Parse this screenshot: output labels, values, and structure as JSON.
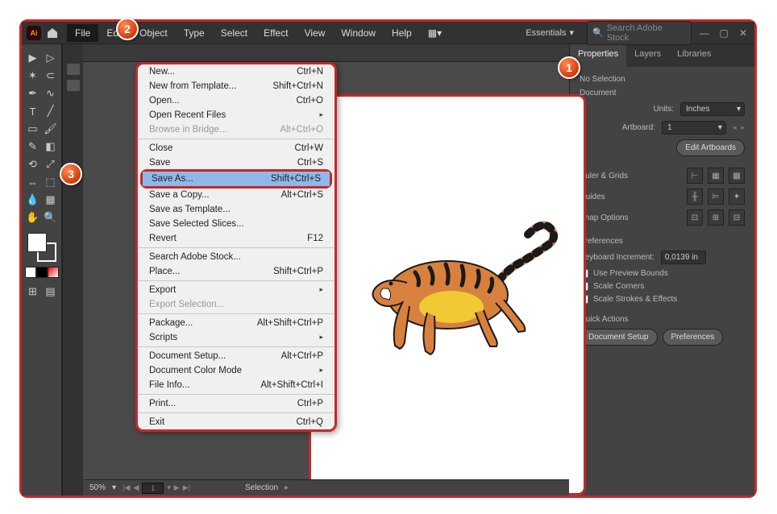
{
  "menubar": {
    "items": [
      "File",
      "Edit",
      "Object",
      "Type",
      "Select",
      "Effect",
      "View",
      "Window",
      "Help"
    ],
    "essentials": "Essentials",
    "search_placeholder": "Search Adobe Stock"
  },
  "dropdown": {
    "items": [
      {
        "label": "New...",
        "shortcut": "Ctrl+N"
      },
      {
        "label": "New from Template...",
        "shortcut": "Shift+Ctrl+N"
      },
      {
        "label": "Open...",
        "shortcut": "Ctrl+O"
      },
      {
        "label": "Open Recent Files",
        "sub": true
      },
      {
        "label": "Browse in Bridge...",
        "shortcut": "Alt+Ctrl+O",
        "disabled": true
      },
      {
        "sep": true
      },
      {
        "label": "Close",
        "shortcut": "Ctrl+W"
      },
      {
        "label": "Save",
        "shortcut": "Ctrl+S"
      },
      {
        "label": "Save As...",
        "shortcut": "Shift+Ctrl+S",
        "highlight": true
      },
      {
        "label": "Save a Copy...",
        "shortcut": "Alt+Ctrl+S"
      },
      {
        "label": "Save as Template..."
      },
      {
        "label": "Save Selected Slices..."
      },
      {
        "label": "Revert",
        "shortcut": "F12"
      },
      {
        "sep": true
      },
      {
        "label": "Search Adobe Stock..."
      },
      {
        "label": "Place...",
        "shortcut": "Shift+Ctrl+P"
      },
      {
        "sep": true
      },
      {
        "label": "Export",
        "sub": true
      },
      {
        "label": "Export Selection...",
        "disabled": true
      },
      {
        "sep": true
      },
      {
        "label": "Package...",
        "shortcut": "Alt+Shift+Ctrl+P"
      },
      {
        "label": "Scripts",
        "sub": true
      },
      {
        "sep": true
      },
      {
        "label": "Document Setup...",
        "shortcut": "Alt+Ctrl+P"
      },
      {
        "label": "Document Color Mode",
        "sub": true
      },
      {
        "label": "File Info...",
        "shortcut": "Alt+Shift+Ctrl+I"
      },
      {
        "sep": true
      },
      {
        "label": "Print...",
        "shortcut": "Ctrl+P"
      },
      {
        "sep": true
      },
      {
        "label": "Exit",
        "shortcut": "Ctrl+Q"
      }
    ]
  },
  "status": {
    "zoom": "50%",
    "page": "1",
    "mode": "Selection"
  },
  "panel": {
    "tabs": [
      "Properties",
      "Layers",
      "Libraries"
    ],
    "title": "No Selection",
    "doc_section": "Document",
    "units_label": "Units:",
    "units_value": "Inches",
    "artboard_label": "Artboard:",
    "artboard_value": "1",
    "edit_artboards": "Edit Artboards",
    "ruler_grids": "Ruler & Grids",
    "guides": "Guides",
    "snap_options": "Snap Options",
    "preferences_section": "Preferences",
    "keyboard_inc_label": "Keyboard Increment:",
    "keyboard_inc_value": "0,0139 in",
    "chk1": "Use Preview Bounds",
    "chk2": "Scale Corners",
    "chk3": "Scale Strokes & Effects",
    "quick_actions": "Quick Actions",
    "btn_doc_setup": "Document Setup",
    "btn_prefs": "Preferences"
  },
  "callouts": {
    "c1": "1",
    "c2": "2",
    "c3": "3"
  }
}
